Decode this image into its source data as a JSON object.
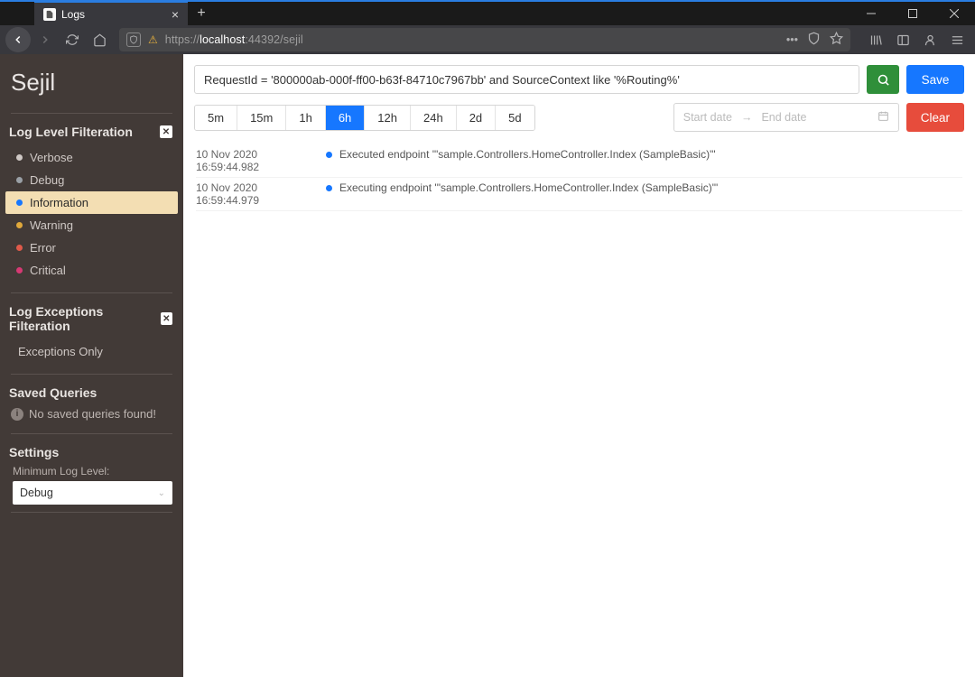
{
  "browser": {
    "tab_title": "Logs",
    "url_prefix": "https://",
    "url_host": "localhost",
    "url_suffix": ":44392/sejil"
  },
  "brand": "Sejil",
  "log_level_filter": {
    "title": "Log Level Filteration",
    "levels": [
      {
        "name": "Verbose",
        "color": "#cfc8c5",
        "selected": false
      },
      {
        "name": "Debug",
        "color": "#9aa0a6",
        "selected": false
      },
      {
        "name": "Information",
        "color": "#1677ff",
        "selected": true
      },
      {
        "name": "Warning",
        "color": "#e0a83b",
        "selected": false
      },
      {
        "name": "Error",
        "color": "#e05a4a",
        "selected": false
      },
      {
        "name": "Critical",
        "color": "#d63973",
        "selected": false
      }
    ]
  },
  "exceptions_filter": {
    "title": "Log Exceptions Filteration",
    "option": "Exceptions Only"
  },
  "saved_queries": {
    "title": "Saved Queries",
    "empty_message": "No saved queries found!"
  },
  "settings": {
    "title": "Settings",
    "min_level_label": "Minimum Log Level:",
    "min_level_value": "Debug"
  },
  "query": {
    "text": "RequestId = '800000ab-000f-ff00-b63f-84710c7967bb' and SourceContext like '%Routing%'",
    "save_label": "Save",
    "clear_label": "Clear"
  },
  "ranges": [
    "5m",
    "15m",
    "1h",
    "6h",
    "12h",
    "24h",
    "2d",
    "5d"
  ],
  "active_range": "6h",
  "date_placeholder_start": "Start date",
  "date_placeholder_end": "End date",
  "logs": [
    {
      "ts": "10 Nov 2020 16:59:44.982",
      "level_color": "#1677ff",
      "msg": "Executed endpoint '\"sample.Controllers.HomeController.Index (SampleBasic)\"'"
    },
    {
      "ts": "10 Nov 2020 16:59:44.979",
      "level_color": "#1677ff",
      "msg": "Executing endpoint '\"sample.Controllers.HomeController.Index (SampleBasic)\"'"
    }
  ]
}
